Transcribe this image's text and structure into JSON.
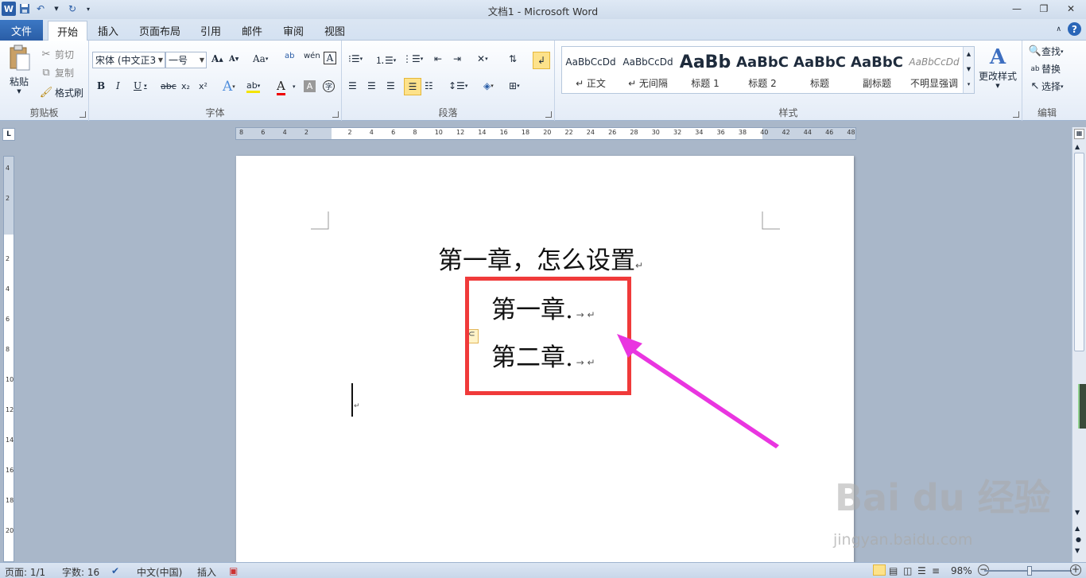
{
  "window": {
    "title": "文档1 - Microsoft Word"
  },
  "tabs": {
    "file": "文件",
    "items": [
      "开始",
      "插入",
      "页面布局",
      "引用",
      "邮件",
      "审阅",
      "视图"
    ]
  },
  "clipboard": {
    "paste": "粘贴",
    "cut": "剪切",
    "copy": "复制",
    "format_painter": "格式刷",
    "group": "剪贴板"
  },
  "font": {
    "name": "宋体 (中文正3",
    "size": "一号",
    "group": "字体"
  },
  "paragraph": {
    "group": "段落"
  },
  "styles": {
    "group": "样式",
    "items": [
      {
        "preview": "AaBbCcDd",
        "label": "↵ 正文"
      },
      {
        "preview": "AaBbCcDd",
        "label": "↵ 无间隔"
      },
      {
        "preview": "AaBb",
        "label": "标题 1"
      },
      {
        "preview": "AaBbC",
        "label": "标题 2"
      },
      {
        "preview": "AaBbC",
        "label": "标题"
      },
      {
        "preview": "AaBbC",
        "label": "副标题"
      },
      {
        "preview": "AaBbCcDd",
        "label": "不明显强调"
      }
    ],
    "change_styles": "更改样式"
  },
  "editing": {
    "find": "查找",
    "replace": "替换",
    "select": "选择",
    "group": "编辑"
  },
  "ruler": {
    "h_labels": [
      "8",
      "6",
      "4",
      "2",
      "",
      "2",
      "4",
      "6",
      "8",
      "10",
      "12",
      "14",
      "16",
      "18",
      "20",
      "22",
      "24",
      "26",
      "28",
      "30",
      "32",
      "34",
      "36",
      "38",
      "40",
      "42",
      "44",
      "46",
      "48"
    ],
    "v_labels": [
      "4",
      "2",
      "",
      "2",
      "4",
      "6",
      "8",
      "10",
      "12",
      "14",
      "16",
      "18",
      "20"
    ]
  },
  "document": {
    "line1": "第一章，怎么设置",
    "line2": "第一章.",
    "line3": "第二章."
  },
  "status": {
    "page": "页面: 1/1",
    "words": "字数: 16",
    "language": "中文(中国)",
    "mode": "插入",
    "zoom": "98%"
  },
  "watermark": {
    "brand": "Bai du 经验",
    "url": "jingyan.baidu.com"
  },
  "colors": {
    "highlight_box": "#f03a3a",
    "arrow": "#e935e0"
  }
}
